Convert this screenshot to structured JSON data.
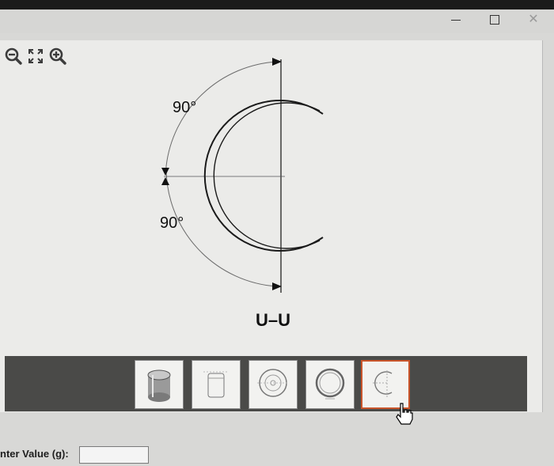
{
  "window": {
    "controls": {
      "minimize_icon": "minimize-icon",
      "maximize_icon": "maximize-icon",
      "close_icon": "close-icon",
      "close_glyph": "✕"
    }
  },
  "toolbar": {
    "icons": [
      "zoom-out-icon",
      "fit-to-screen-icon",
      "zoom-in-icon"
    ]
  },
  "drawing": {
    "angle_top": "90°",
    "angle_bottom": "90°",
    "section_label": "U–U"
  },
  "thumbnails": [
    {
      "name": "thumb-cylinder-3d",
      "selected": false
    },
    {
      "name": "thumb-cylinder-outline",
      "selected": false
    },
    {
      "name": "thumb-ring-front",
      "selected": false
    },
    {
      "name": "thumb-ring-detail",
      "selected": false
    },
    {
      "name": "thumb-section-u-u",
      "selected": true
    }
  ],
  "form": {
    "value_label": "nter Value (g):",
    "value_input": ""
  },
  "colors": {
    "selection_border": "#c9542a",
    "strip_background": "#4a4a48",
    "viewer_background": "#ebebe9"
  }
}
